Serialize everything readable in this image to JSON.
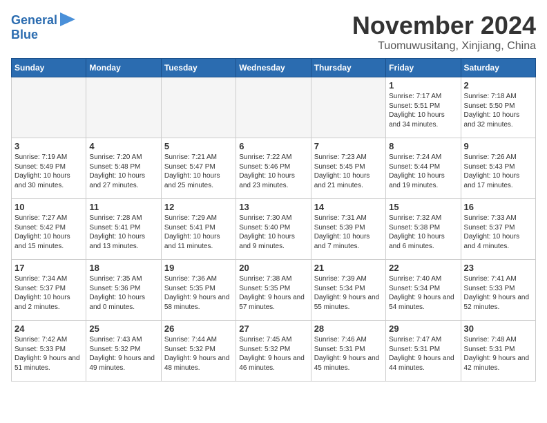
{
  "logo": {
    "line1": "General",
    "line2": "Blue"
  },
  "title": "November 2024",
  "location": "Tuomuwusitang, Xinjiang, China",
  "headers": [
    "Sunday",
    "Monday",
    "Tuesday",
    "Wednesday",
    "Thursday",
    "Friday",
    "Saturday"
  ],
  "weeks": [
    [
      {
        "day": "",
        "info": "",
        "empty": true
      },
      {
        "day": "",
        "info": "",
        "empty": true
      },
      {
        "day": "",
        "info": "",
        "empty": true
      },
      {
        "day": "",
        "info": "",
        "empty": true
      },
      {
        "day": "",
        "info": "",
        "empty": true
      },
      {
        "day": "1",
        "info": "Sunrise: 7:17 AM\nSunset: 5:51 PM\nDaylight: 10 hours and 34 minutes.",
        "empty": false
      },
      {
        "day": "2",
        "info": "Sunrise: 7:18 AM\nSunset: 5:50 PM\nDaylight: 10 hours and 32 minutes.",
        "empty": false
      }
    ],
    [
      {
        "day": "3",
        "info": "Sunrise: 7:19 AM\nSunset: 5:49 PM\nDaylight: 10 hours and 30 minutes.",
        "empty": false
      },
      {
        "day": "4",
        "info": "Sunrise: 7:20 AM\nSunset: 5:48 PM\nDaylight: 10 hours and 27 minutes.",
        "empty": false
      },
      {
        "day": "5",
        "info": "Sunrise: 7:21 AM\nSunset: 5:47 PM\nDaylight: 10 hours and 25 minutes.",
        "empty": false
      },
      {
        "day": "6",
        "info": "Sunrise: 7:22 AM\nSunset: 5:46 PM\nDaylight: 10 hours and 23 minutes.",
        "empty": false
      },
      {
        "day": "7",
        "info": "Sunrise: 7:23 AM\nSunset: 5:45 PM\nDaylight: 10 hours and 21 minutes.",
        "empty": false
      },
      {
        "day": "8",
        "info": "Sunrise: 7:24 AM\nSunset: 5:44 PM\nDaylight: 10 hours and 19 minutes.",
        "empty": false
      },
      {
        "day": "9",
        "info": "Sunrise: 7:26 AM\nSunset: 5:43 PM\nDaylight: 10 hours and 17 minutes.",
        "empty": false
      }
    ],
    [
      {
        "day": "10",
        "info": "Sunrise: 7:27 AM\nSunset: 5:42 PM\nDaylight: 10 hours and 15 minutes.",
        "empty": false
      },
      {
        "day": "11",
        "info": "Sunrise: 7:28 AM\nSunset: 5:41 PM\nDaylight: 10 hours and 13 minutes.",
        "empty": false
      },
      {
        "day": "12",
        "info": "Sunrise: 7:29 AM\nSunset: 5:41 PM\nDaylight: 10 hours and 11 minutes.",
        "empty": false
      },
      {
        "day": "13",
        "info": "Sunrise: 7:30 AM\nSunset: 5:40 PM\nDaylight: 10 hours and 9 minutes.",
        "empty": false
      },
      {
        "day": "14",
        "info": "Sunrise: 7:31 AM\nSunset: 5:39 PM\nDaylight: 10 hours and 7 minutes.",
        "empty": false
      },
      {
        "day": "15",
        "info": "Sunrise: 7:32 AM\nSunset: 5:38 PM\nDaylight: 10 hours and 6 minutes.",
        "empty": false
      },
      {
        "day": "16",
        "info": "Sunrise: 7:33 AM\nSunset: 5:37 PM\nDaylight: 10 hours and 4 minutes.",
        "empty": false
      }
    ],
    [
      {
        "day": "17",
        "info": "Sunrise: 7:34 AM\nSunset: 5:37 PM\nDaylight: 10 hours and 2 minutes.",
        "empty": false
      },
      {
        "day": "18",
        "info": "Sunrise: 7:35 AM\nSunset: 5:36 PM\nDaylight: 10 hours and 0 minutes.",
        "empty": false
      },
      {
        "day": "19",
        "info": "Sunrise: 7:36 AM\nSunset: 5:35 PM\nDaylight: 9 hours and 58 minutes.",
        "empty": false
      },
      {
        "day": "20",
        "info": "Sunrise: 7:38 AM\nSunset: 5:35 PM\nDaylight: 9 hours and 57 minutes.",
        "empty": false
      },
      {
        "day": "21",
        "info": "Sunrise: 7:39 AM\nSunset: 5:34 PM\nDaylight: 9 hours and 55 minutes.",
        "empty": false
      },
      {
        "day": "22",
        "info": "Sunrise: 7:40 AM\nSunset: 5:34 PM\nDaylight: 9 hours and 54 minutes.",
        "empty": false
      },
      {
        "day": "23",
        "info": "Sunrise: 7:41 AM\nSunset: 5:33 PM\nDaylight: 9 hours and 52 minutes.",
        "empty": false
      }
    ],
    [
      {
        "day": "24",
        "info": "Sunrise: 7:42 AM\nSunset: 5:33 PM\nDaylight: 9 hours and 51 minutes.",
        "empty": false
      },
      {
        "day": "25",
        "info": "Sunrise: 7:43 AM\nSunset: 5:32 PM\nDaylight: 9 hours and 49 minutes.",
        "empty": false
      },
      {
        "day": "26",
        "info": "Sunrise: 7:44 AM\nSunset: 5:32 PM\nDaylight: 9 hours and 48 minutes.",
        "empty": false
      },
      {
        "day": "27",
        "info": "Sunrise: 7:45 AM\nSunset: 5:32 PM\nDaylight: 9 hours and 46 minutes.",
        "empty": false
      },
      {
        "day": "28",
        "info": "Sunrise: 7:46 AM\nSunset: 5:31 PM\nDaylight: 9 hours and 45 minutes.",
        "empty": false
      },
      {
        "day": "29",
        "info": "Sunrise: 7:47 AM\nSunset: 5:31 PM\nDaylight: 9 hours and 44 minutes.",
        "empty": false
      },
      {
        "day": "30",
        "info": "Sunrise: 7:48 AM\nSunset: 5:31 PM\nDaylight: 9 hours and 42 minutes.",
        "empty": false
      }
    ]
  ]
}
